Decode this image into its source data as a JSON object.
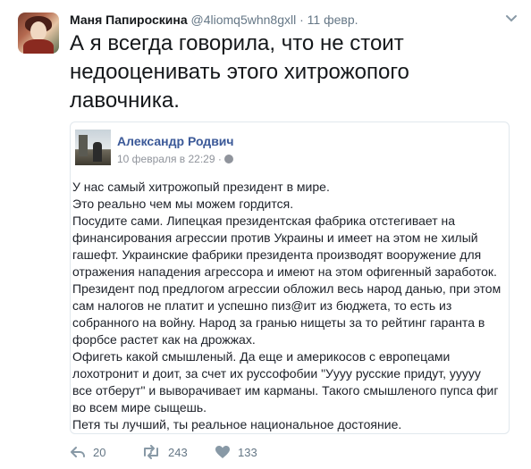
{
  "tweet": {
    "author_name": "Маня Папироскина",
    "handle": "@4liomq5whn8gxll",
    "separator": "·",
    "date": "11 февр.",
    "text": "А я всегда говорила, что не стоит недооценивать этого хитрожопого лавочника.",
    "icons": {
      "menu": "chevron-down-icon",
      "reply": "reply-icon",
      "retweet": "retweet-icon",
      "like": "heart-icon",
      "privacy": "globe-icon"
    },
    "actions": {
      "reply_count": "20",
      "retweet_count": "243",
      "like_count": "133"
    }
  },
  "quoted_post": {
    "author_name": "Александр Родвич",
    "date": "10 февраля в 22:29 ·",
    "lines": [
      "У нас самый хитрожопый президент в мире.",
      "Это реально чем мы можем гордится.",
      "Посудите сами. Липецкая президентская фабрика отстегивает на",
      "финансирования агрессии против Украины и имеет на этом не хилый",
      "гашефт. Украинские фабрики президента производят вооружение для",
      "отражения нападения агрессора и имеют на этом офигенный заработок.",
      "Президент под предлогом агрессии обложил весь народ данью, при этом",
      "сам налогов не платит и успешно пиз@ит из бюджета, то есть из",
      "собранного на войну. Народ за гранью нищеты за то рейтинг гаранта в",
      "форбсе растет как на дрожжах.",
      "Офигеть какой смышленый. Да еще и америкосов с европецами",
      "лохотронит и доит, за счет их руссофобии \"Уууу русские придут, ууууу",
      "все отберут\" и выворачивает им карманы. Такого смышленого пупса фиг",
      "во всем мире сыщешь.",
      "Петя ты лучший, ты реальное национальное достояние."
    ]
  }
}
